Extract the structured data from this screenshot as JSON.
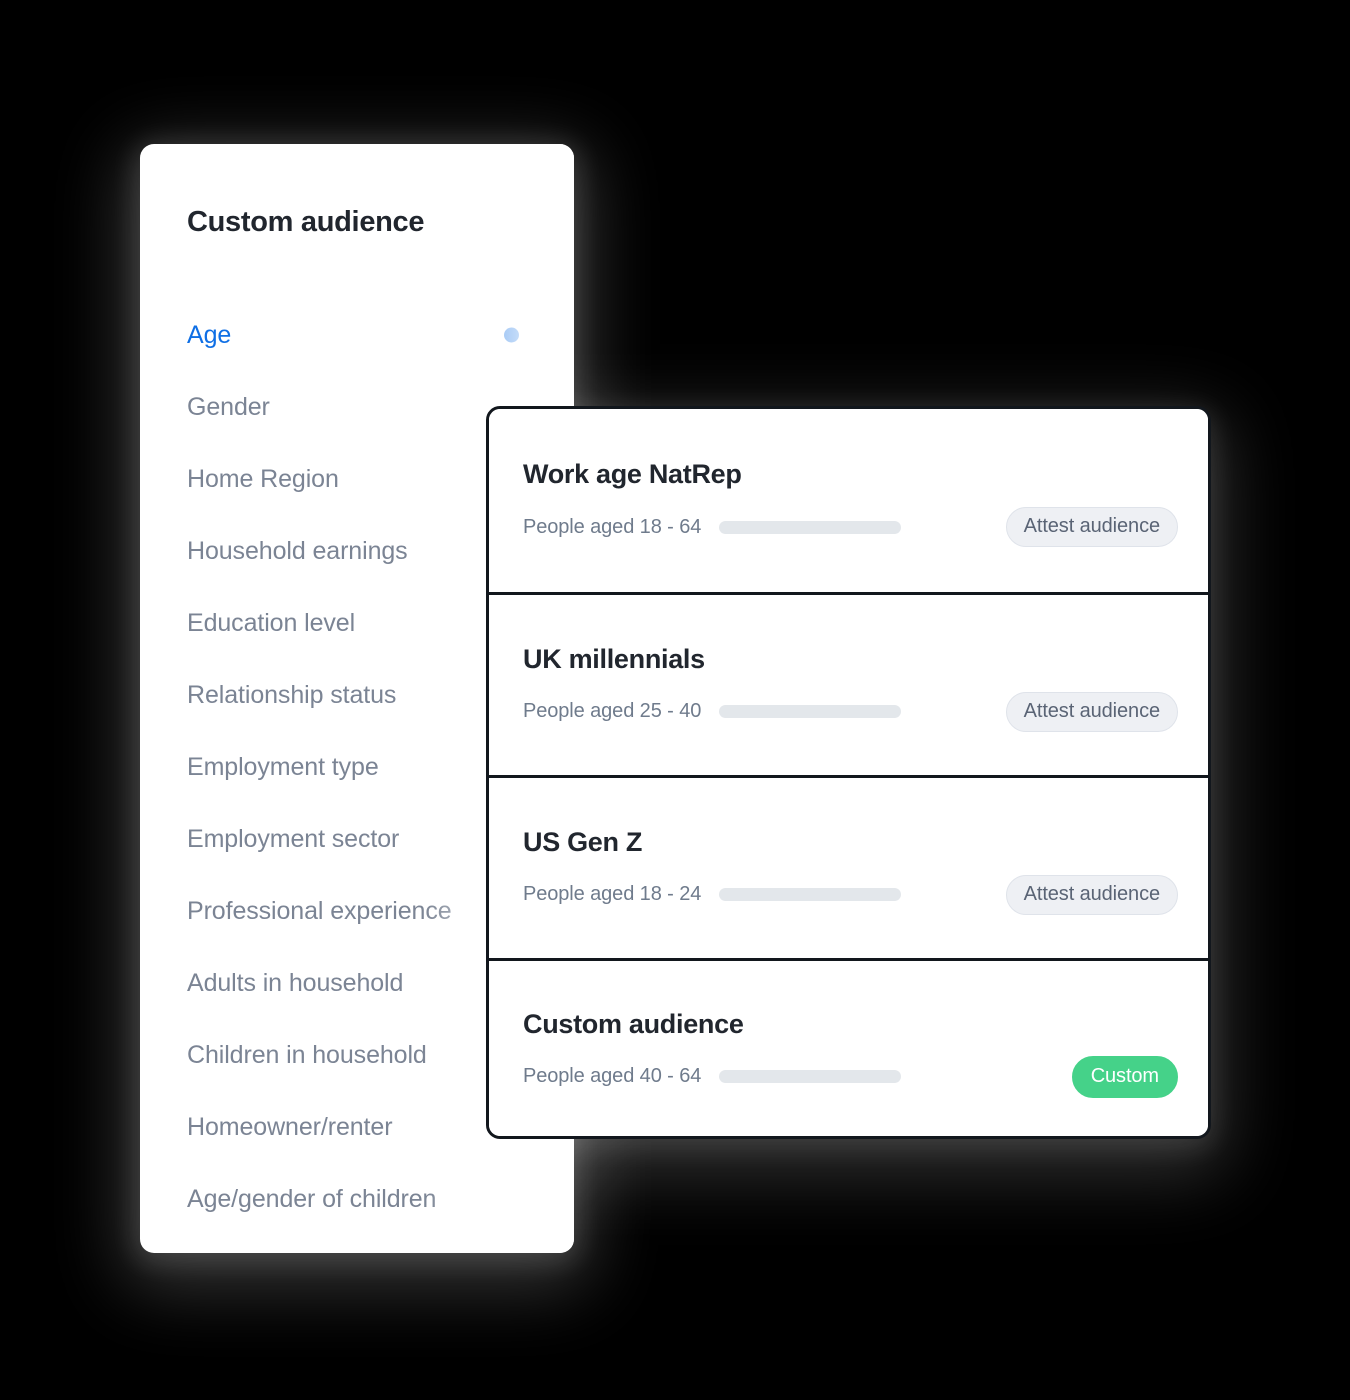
{
  "theme": {
    "background": "#000000",
    "panel_bg": "#ffffff",
    "accent_blue": "#0f6fe5",
    "accent_green": "#45d289",
    "title_color": "#21262e",
    "muted_text": "#7b8494",
    "border_dark": "#12171d",
    "skeleton_gray": "#e3e7eb",
    "pill_gray_bg": "#eef0f4"
  },
  "sidebar": {
    "title": "Custom audience",
    "items": [
      {
        "label": "Age",
        "active": true,
        "dot": true
      },
      {
        "label": "Gender",
        "active": false,
        "dot": false
      },
      {
        "label": "Home Region",
        "active": false,
        "dot": false
      },
      {
        "label": "Household earnings",
        "active": false,
        "dot": false
      },
      {
        "label": "Education level",
        "active": false,
        "dot": false
      },
      {
        "label": "Relationship status",
        "active": false,
        "dot": false
      },
      {
        "label": "Employment type",
        "active": false,
        "dot": false
      },
      {
        "label": "Employment sector",
        "active": false,
        "dot": false
      },
      {
        "label": "Professional experience",
        "active": false,
        "dot": false
      },
      {
        "label": "Adults in household",
        "active": false,
        "dot": false
      },
      {
        "label": "Children in household",
        "active": false,
        "dot": false
      },
      {
        "label": "Homeowner/renter",
        "active": false,
        "dot": false
      },
      {
        "label": "Age/gender of children",
        "active": false,
        "dot": false
      }
    ]
  },
  "audiences": {
    "rows": [
      {
        "name": "Work age NatRep",
        "description": "People aged 18 - 64",
        "badge": "Attest audience",
        "badge_type": "attest"
      },
      {
        "name": "UK millennials",
        "description": "People aged 25 - 40",
        "badge": "Attest audience",
        "badge_type": "attest"
      },
      {
        "name": "US Gen Z",
        "description": "People aged 18 - 24",
        "badge": "Attest audience",
        "badge_type": "attest"
      },
      {
        "name": "Custom audience",
        "description": "People aged 40 - 64",
        "badge": "Custom",
        "badge_type": "custom"
      }
    ]
  }
}
